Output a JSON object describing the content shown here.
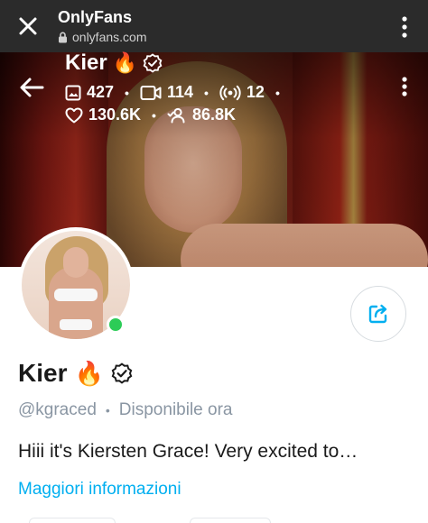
{
  "browser": {
    "title": "OnlyFans",
    "url": "onlyfans.com"
  },
  "cover": {
    "name": "Kier",
    "name_emoji": "🔥",
    "stats": {
      "photos": "427",
      "videos": "114",
      "streams": "12",
      "likes": "130.6K",
      "fans": "86.8K"
    }
  },
  "profile": {
    "name": "Kier",
    "name_emoji": "🔥",
    "handle": "@kgraced",
    "status": "Disponibile ora",
    "bio": "Hiii it's Kiersten Grace! Very excited to…",
    "more_link": "Maggiori informazioni"
  },
  "colors": {
    "accent": "#00aff0",
    "online": "#2ccc57",
    "muted_text": "#8a96a3",
    "browser_bar": "#2b2b2b"
  },
  "icons": [
    "close-icon",
    "lock-icon",
    "more-vertical-icon",
    "back-arrow-icon",
    "verified-icon",
    "image-icon",
    "video-icon",
    "stream-icon",
    "heart-icon",
    "fans-icon",
    "share-icon"
  ]
}
